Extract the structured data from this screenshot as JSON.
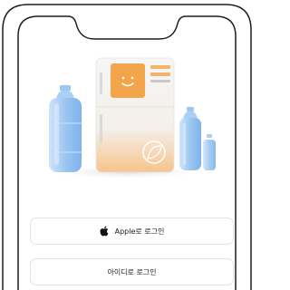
{
  "buttons": {
    "apple_login": {
      "label": "Apple로 로그인",
      "icon": "apple-logo-icon"
    },
    "id_login": {
      "label": "아이디로 로그인"
    }
  },
  "colors": {
    "frame": "#1f1f1f",
    "fridge_accent": "#f2a54a",
    "bottle": "#9cc6f0",
    "button_border": "#e3e3e6",
    "text": "#1c1c1e"
  }
}
